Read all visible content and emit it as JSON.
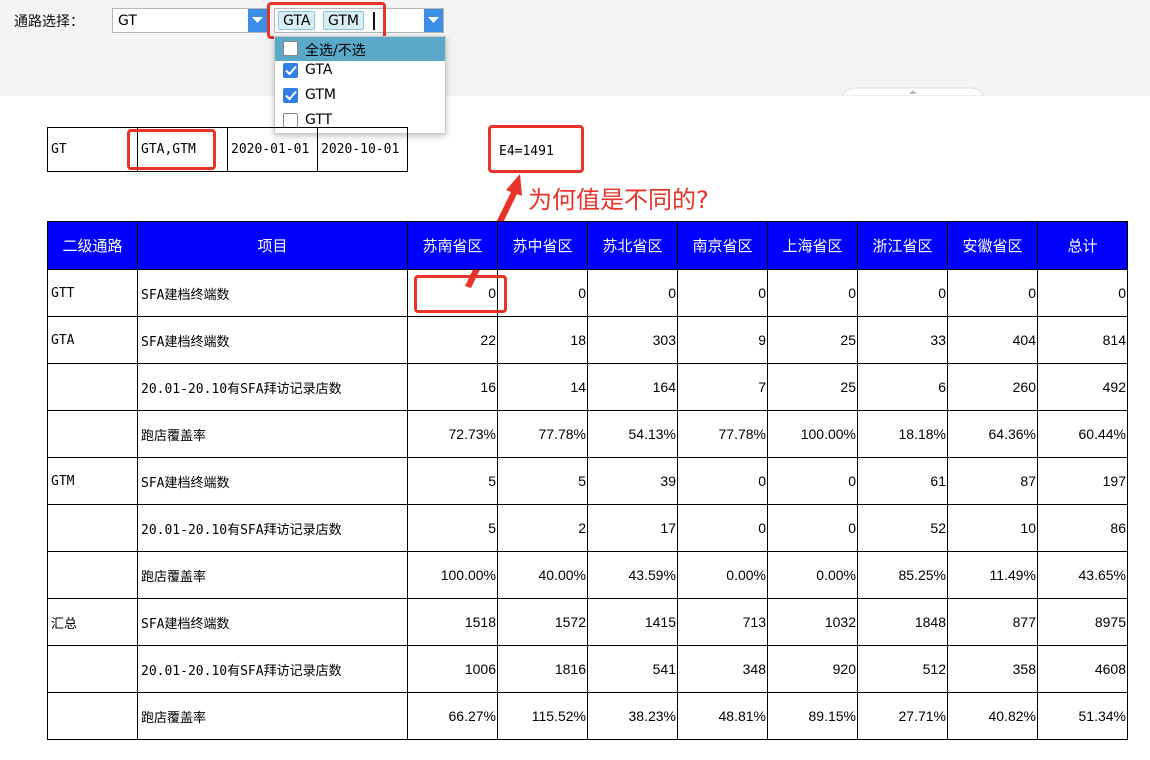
{
  "filter": {
    "label": "通路选择：",
    "primary_value": "GT",
    "selected_tags": [
      "GTA",
      "GTM"
    ],
    "options": [
      {
        "label": "全选/不选",
        "checked": false
      },
      {
        "label": "GTA",
        "checked": true
      },
      {
        "label": "GTM",
        "checked": true
      },
      {
        "label": "GTT",
        "checked": false
      }
    ]
  },
  "params": [
    "GT",
    "GTA,GTM",
    "2020-01-01",
    "2020-10-01"
  ],
  "e4_text": "E4=1491",
  "annotation": "为何值是不同的?",
  "colors": {
    "header_bg": "#0000ff",
    "highlight": "#e8322a",
    "dropdown_btn": "#3a8ee6"
  },
  "table": {
    "headers": [
      "二级通路",
      "项目",
      "苏南省区",
      "苏中省区",
      "苏北省区",
      "南京省区",
      "上海省区",
      "浙江省区",
      "安徽省区",
      "总计"
    ],
    "rows": [
      {
        "channel": "GTT",
        "item": "SFA建档终端数",
        "values": [
          "0",
          "0",
          "0",
          "0",
          "0",
          "0",
          "0",
          "0"
        ]
      },
      {
        "channel": "GTA",
        "item": "SFA建档终端数",
        "values": [
          "22",
          "18",
          "303",
          "9",
          "25",
          "33",
          "404",
          "814"
        ]
      },
      {
        "channel": "",
        "item": "20.01-20.10有SFA拜访记录店数",
        "values": [
          "16",
          "14",
          "164",
          "7",
          "25",
          "6",
          "260",
          "492"
        ]
      },
      {
        "channel": "",
        "item": "跑店覆盖率",
        "values": [
          "72.73%",
          "77.78%",
          "54.13%",
          "77.78%",
          "100.00%",
          "18.18%",
          "64.36%",
          "60.44%"
        ]
      },
      {
        "channel": "GTM",
        "item": "SFA建档终端数",
        "values": [
          "5",
          "5",
          "39",
          "0",
          "0",
          "61",
          "87",
          "197"
        ]
      },
      {
        "channel": "",
        "item": "20.01-20.10有SFA拜访记录店数",
        "values": [
          "5",
          "2",
          "17",
          "0",
          "0",
          "52",
          "10",
          "86"
        ]
      },
      {
        "channel": "",
        "item": "跑店覆盖率",
        "values": [
          "100.00%",
          "40.00%",
          "43.59%",
          "0.00%",
          "0.00%",
          "85.25%",
          "11.49%",
          "43.65%"
        ]
      },
      {
        "channel": "汇总",
        "item": "SFA建档终端数",
        "values": [
          "1518",
          "1572",
          "1415",
          "713",
          "1032",
          "1848",
          "877",
          "8975"
        ]
      },
      {
        "channel": "",
        "item": "20.01-20.10有SFA拜访记录店数",
        "values": [
          "1006",
          "1816",
          "541",
          "348",
          "920",
          "512",
          "358",
          "4608"
        ]
      },
      {
        "channel": "",
        "item": "跑店覆盖率",
        "values": [
          "66.27%",
          "115.52%",
          "38.23%",
          "48.81%",
          "89.15%",
          "27.71%",
          "40.82%",
          "51.34%"
        ]
      }
    ]
  }
}
